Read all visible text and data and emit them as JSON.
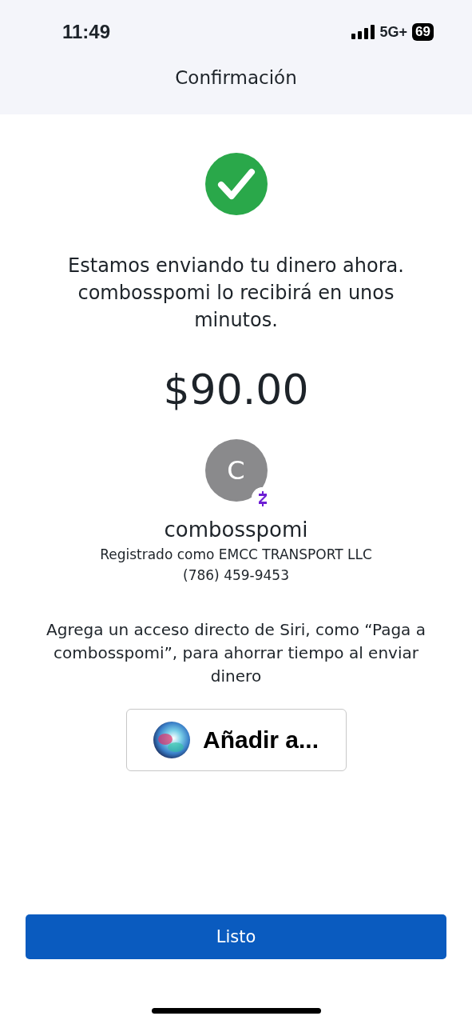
{
  "status_bar": {
    "time": "11:49",
    "network": "5G+",
    "battery": "69"
  },
  "header": {
    "title": "Confirmación"
  },
  "message": "Estamos enviando tu dinero ahora. combosspomi lo recibirá en unos minutos.",
  "amount": "$90.00",
  "recipient": {
    "initial": "C",
    "name": "combosspomi",
    "registered": "Registrado como EMCC TRANSPORT LLC",
    "phone": "(786) 459-9453"
  },
  "siri": {
    "text": "Agrega un acceso directo de Siri, como “Paga a combosspomi”, para ahorrar tiempo al enviar dinero",
    "button": "Añadir a..."
  },
  "done_button": "Listo"
}
